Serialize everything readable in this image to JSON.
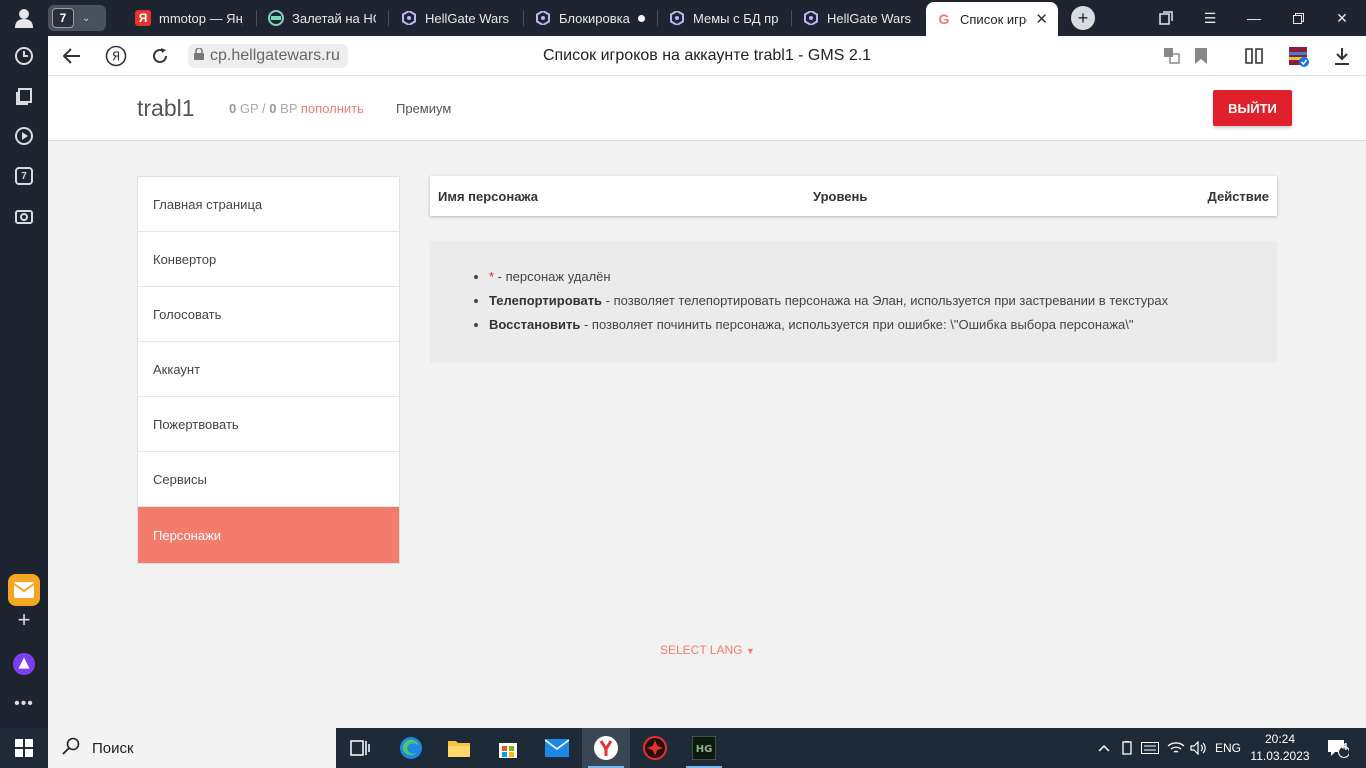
{
  "browser": {
    "tab_group_count": "7",
    "tabs": [
      {
        "label": "mmotop — Янд",
        "icon": "yandex-icon"
      },
      {
        "label": "Залетай на HG",
        "icon": "tab-site-icon"
      },
      {
        "label": "HellGate Wars",
        "icon": "hellgate-icon"
      },
      {
        "label": "Блокировка",
        "icon": "hellgate-icon"
      },
      {
        "label": "Мемы с БД про",
        "icon": "hellgate-icon"
      },
      {
        "label": "HellGate Wars",
        "icon": "hellgate-icon"
      },
      {
        "label": "Список игроков",
        "icon": "gms-icon"
      }
    ],
    "url": "cp.hellgatewars.ru",
    "page_title": "Список игроков на аккаунте trabl1 - GMS 2.1",
    "sidepanel_badge": "7"
  },
  "header": {
    "username": "trabl1",
    "gp_value": "0",
    "gp_unit": "GP",
    "separator": "/",
    "bp_value": "0",
    "bp_unit": "BP",
    "topup_label": "пополнить",
    "premium_label": "Премиум",
    "logout_label": "ВЫЙТИ"
  },
  "menu": {
    "items": [
      {
        "label": "Главная страница"
      },
      {
        "label": "Конвертор"
      },
      {
        "label": "Голосовать"
      },
      {
        "label": "Аккаунт"
      },
      {
        "label": "Пожертвовать"
      },
      {
        "label": "Сервисы"
      },
      {
        "label": "Персонажи"
      }
    ],
    "active_index": 6
  },
  "table": {
    "columns": [
      "Имя персонажа",
      "Уровень",
      "Действие"
    ],
    "rows": []
  },
  "notes": [
    {
      "marker": "*",
      "bold": "",
      "text": " - персонаж удалён"
    },
    {
      "marker": "",
      "bold": "Телепортировать",
      "text": " - позволяет телепортировать персонажа на Элан, используется при застревании в текстурах"
    },
    {
      "marker": "",
      "bold": "Восстановить",
      "text": " - позволяет починить персонажа, используется при ошибке: \\\"Ошибка выбора персонажа\\\""
    }
  ],
  "footer": {
    "select_lang": "SELECT LANG"
  },
  "taskbar": {
    "search_placeholder": "Поиск",
    "lang": "ENG",
    "time": "20:24",
    "date": "11.03.2023",
    "notifications": "4"
  },
  "colors": {
    "accent": "#f47c6c",
    "logout": "#e0202d",
    "chrome_dark": "#1e2430"
  }
}
